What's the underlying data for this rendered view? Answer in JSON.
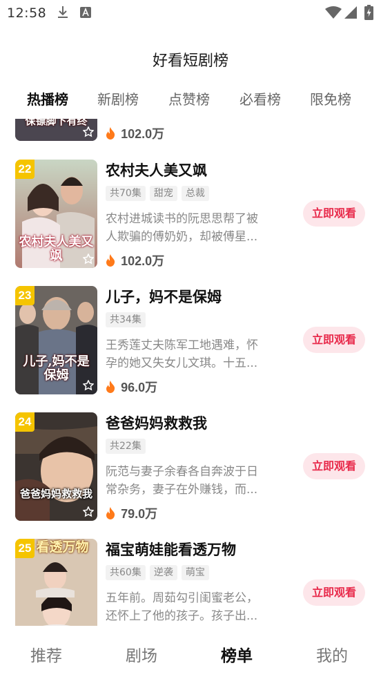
{
  "status": {
    "time": "12:58"
  },
  "header": {
    "title": "好看短剧榜"
  },
  "tabs": [
    {
      "label": "热播榜",
      "active": true
    },
    {
      "label": "新剧榜"
    },
    {
      "label": "点赞榜"
    },
    {
      "label": "必看榜"
    },
    {
      "label": "限免榜"
    }
  ],
  "partial_item": {
    "poster_text": "保镖脚下有终",
    "heat": "102.0万"
  },
  "items": [
    {
      "rank": "22",
      "title": "农村夫人美又飒",
      "tags": [
        "共70集",
        "甜宠",
        "总裁"
      ],
      "desc_line1": "农村进城读书的阮思思帮了被",
      "desc_line2": "人欺骗的傅奶奶，却被傅星...",
      "heat": "102.0万",
      "poster_text": "农村夫人美又飒",
      "button": "立即观看"
    },
    {
      "rank": "23",
      "title": "儿子，妈不是保姆",
      "tags": [
        "共34集"
      ],
      "desc_line1": "王秀莲丈夫陈军工地遇难，怀",
      "desc_line2": "孕的她又失女儿文琪。十五...",
      "heat": "96.0万",
      "poster_text": "儿子,妈不是保姆",
      "button": "立即观看"
    },
    {
      "rank": "24",
      "title": "爸爸妈妈救救我",
      "tags": [
        "共22集"
      ],
      "desc_line1": "阮范与妻子余春各自奔波于日",
      "desc_line2": "常杂务，妻子在外赚钱，而...",
      "heat": "79.0万",
      "poster_text": "爸爸妈妈救救我",
      "button": "立即观看"
    },
    {
      "rank": "25",
      "title": "福宝萌娃能看透万物",
      "tags": [
        "共60集",
        "逆袭",
        "萌宝"
      ],
      "desc_line1": "五年前。周茹勾引闺蜜老公，",
      "desc_line2": "还怀上了他的孩子。孩子出...",
      "heat": "",
      "poster_text": "看透万物",
      "button": "立即观看"
    }
  ],
  "bottom_nav": [
    {
      "label": "推荐"
    },
    {
      "label": "剧场"
    },
    {
      "label": "榜单",
      "active": true
    },
    {
      "label": "我的"
    }
  ]
}
